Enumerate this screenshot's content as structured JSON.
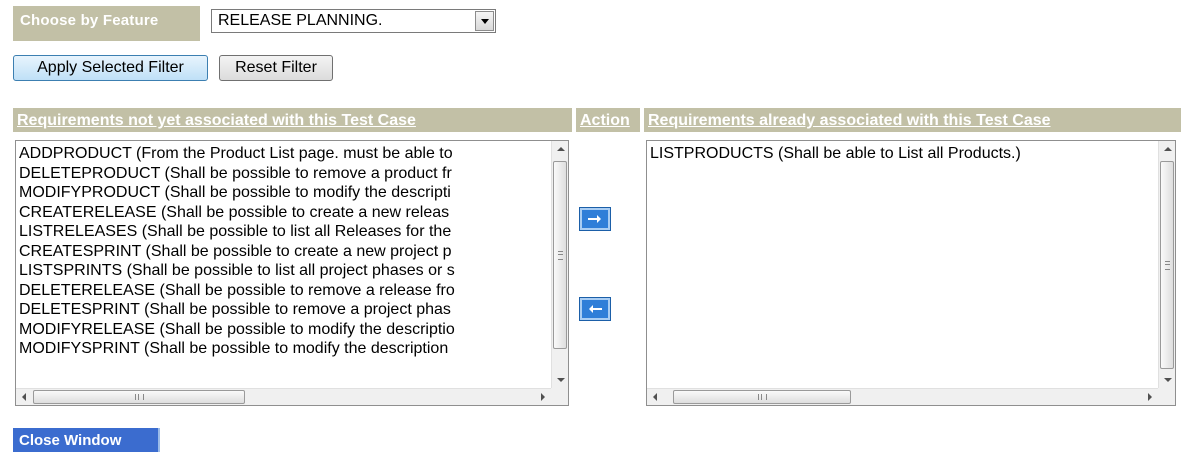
{
  "filter": {
    "label": "Choose by Feature",
    "selected": "RELEASE PLANNING.",
    "apply_label": "Apply Selected Filter",
    "reset_label": "Reset Filter"
  },
  "headers": {
    "not_associated": "Requirements not yet associated with this Test Case",
    "action": "Action",
    "associated": "Requirements already associated with this Test Case"
  },
  "available": [
    "ADDPRODUCT (From the Product List page. must be able to",
    "DELETEPRODUCT (Shall be possible to remove a product fr",
    "MODIFYPRODUCT (Shall be possible to modify the descripti",
    "CREATERELEASE (Shall be possible to create a new releas",
    "LISTRELEASES (Shall be possible to list all Releases for the",
    "CREATESPRINT (Shall be possible to create a new project p",
    "LISTSPRINTS (Shall be possible to list all project phases or s",
    "DELETERELEASE (Shall be possible to remove a release fro",
    "DELETESPRINT (Shall be possible to remove a project phas",
    "MODIFYRELEASE (Shall be possible to modify the descriptio",
    "MODIFYSPRINT (Shall be possible to modify the description"
  ],
  "associated": [
    "LISTPRODUCTS (Shall be able to List all Products.)"
  ],
  "actions": {
    "add_icon": "arrow-right-icon",
    "remove_icon": "arrow-left-icon"
  },
  "close_label": "Close Window",
  "colors": {
    "header_bg": "#c2c0a6",
    "header_text": "#ffffff",
    "action_button": "#2f7ed8",
    "close_button": "#3b6ccf"
  }
}
